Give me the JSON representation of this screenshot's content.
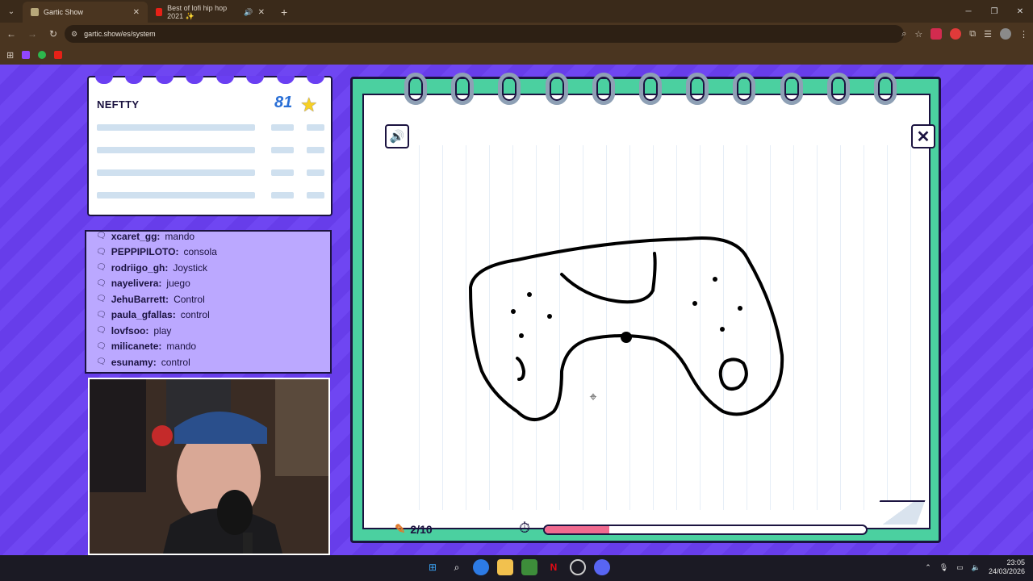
{
  "browser": {
    "tabs": [
      {
        "title": "Gartic Show",
        "active": true
      },
      {
        "title": "Best of lofi hip hop 2021 ✨",
        "active": false
      }
    ],
    "url": "gartic.show/es/system"
  },
  "scoreboard": {
    "player_name": "NEFTTY",
    "score": "81"
  },
  "chat": {
    "messages": [
      {
        "user": "xcaret_gg:",
        "text": "mando"
      },
      {
        "user": "PEPPIPILOTO:",
        "text": "consola"
      },
      {
        "user": "rodriigo_gh:",
        "text": "Joystick"
      },
      {
        "user": "nayelivera:",
        "text": "juego"
      },
      {
        "user": "JehuBarrett:",
        "text": "Control"
      },
      {
        "user": "paula_gfallas:",
        "text": "control"
      },
      {
        "user": "lovfsoo:",
        "text": "play"
      },
      {
        "user": "milicanete:",
        "text": "mando"
      },
      {
        "user": "esunamy:",
        "text": "control"
      }
    ]
  },
  "game": {
    "round": "2/10",
    "timer_progress": 0.2
  },
  "taskbar": {
    "time": "23:05",
    "date": "24/03/2026"
  },
  "colors": {
    "background": "#6a3ff2",
    "notebook_green": "#4bd0a0",
    "timer_fill": "#f06a8f"
  }
}
